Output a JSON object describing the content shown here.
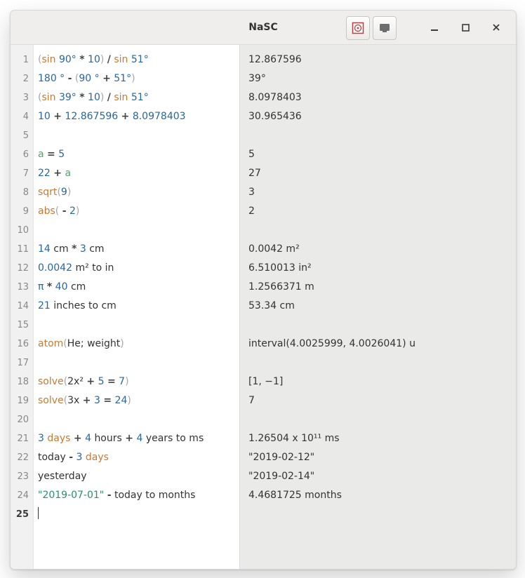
{
  "window": {
    "title": "NaSC"
  },
  "toolbar_icons": {
    "mode": "target-icon",
    "view": "screen-icon"
  },
  "current_line": 25,
  "lines": [
    {
      "n": 1,
      "expr": [
        [
          "paren",
          "("
        ],
        [
          "func",
          "sin"
        ],
        [
          "plain",
          " "
        ],
        [
          "num",
          "90°"
        ],
        [
          "plain",
          " "
        ],
        [
          "op",
          "*"
        ],
        [
          "plain",
          " "
        ],
        [
          "num",
          "10"
        ],
        [
          "paren",
          ")"
        ],
        [
          "plain",
          " "
        ],
        [
          "op",
          "/"
        ],
        [
          "plain",
          " "
        ],
        [
          "func",
          "sin"
        ],
        [
          "plain",
          " "
        ],
        [
          "num",
          "51°"
        ]
      ],
      "result": "12.867596"
    },
    {
      "n": 2,
      "expr": [
        [
          "num",
          "180 °"
        ],
        [
          "plain",
          " "
        ],
        [
          "op",
          "-"
        ],
        [
          "plain",
          " "
        ],
        [
          "paren",
          "("
        ],
        [
          "num",
          "90 °"
        ],
        [
          "plain",
          " "
        ],
        [
          "op",
          "+"
        ],
        [
          "plain",
          " "
        ],
        [
          "num",
          "51°"
        ],
        [
          "paren",
          ")"
        ]
      ],
      "result": "39°"
    },
    {
      "n": 3,
      "expr": [
        [
          "paren",
          "("
        ],
        [
          "func",
          "sin"
        ],
        [
          "plain",
          " "
        ],
        [
          "num",
          "39°"
        ],
        [
          "plain",
          " "
        ],
        [
          "op",
          "*"
        ],
        [
          "plain",
          " "
        ],
        [
          "num",
          "10"
        ],
        [
          "paren",
          ")"
        ],
        [
          "plain",
          " "
        ],
        [
          "op",
          "/"
        ],
        [
          "plain",
          " "
        ],
        [
          "func",
          "sin"
        ],
        [
          "plain",
          " "
        ],
        [
          "num",
          "51°"
        ]
      ],
      "result": "8.0978403"
    },
    {
      "n": 4,
      "expr": [
        [
          "num",
          "10"
        ],
        [
          "plain",
          " "
        ],
        [
          "op",
          "+"
        ],
        [
          "plain",
          " "
        ],
        [
          "num",
          "12.867596"
        ],
        [
          "plain",
          " "
        ],
        [
          "op",
          "+"
        ],
        [
          "plain",
          " "
        ],
        [
          "num",
          "8.0978403"
        ]
      ],
      "result": "30.965436"
    },
    {
      "n": 5,
      "expr": [],
      "result": ""
    },
    {
      "n": 6,
      "expr": [
        [
          "var",
          "a"
        ],
        [
          "plain",
          " "
        ],
        [
          "op",
          "="
        ],
        [
          "plain",
          " "
        ],
        [
          "num",
          "5"
        ]
      ],
      "result": "5"
    },
    {
      "n": 7,
      "expr": [
        [
          "num",
          "22"
        ],
        [
          "plain",
          " "
        ],
        [
          "op",
          "+"
        ],
        [
          "plain",
          " "
        ],
        [
          "var",
          "a"
        ]
      ],
      "result": "27"
    },
    {
      "n": 8,
      "expr": [
        [
          "func",
          "sqrt"
        ],
        [
          "paren",
          "("
        ],
        [
          "num",
          "9"
        ],
        [
          "paren",
          ")"
        ]
      ],
      "result": "3"
    },
    {
      "n": 9,
      "expr": [
        [
          "func",
          "abs"
        ],
        [
          "paren",
          "("
        ],
        [
          "plain",
          " "
        ],
        [
          "op",
          "-"
        ],
        [
          "plain",
          " "
        ],
        [
          "num",
          "2"
        ],
        [
          "paren",
          ")"
        ]
      ],
      "result": "2"
    },
    {
      "n": 10,
      "expr": [],
      "result": ""
    },
    {
      "n": 11,
      "expr": [
        [
          "num",
          "14"
        ],
        [
          "plain",
          " "
        ],
        [
          "kw",
          "cm"
        ],
        [
          "plain",
          " "
        ],
        [
          "op",
          "*"
        ],
        [
          "plain",
          " "
        ],
        [
          "num",
          "3"
        ],
        [
          "plain",
          " "
        ],
        [
          "kw",
          "cm"
        ]
      ],
      "result": "0.0042 m²"
    },
    {
      "n": 12,
      "expr": [
        [
          "num",
          "0.0042"
        ],
        [
          "plain",
          " "
        ],
        [
          "kw",
          "m² to in"
        ]
      ],
      "result": "6.510013 in²"
    },
    {
      "n": 13,
      "expr": [
        [
          "num",
          "π"
        ],
        [
          "plain",
          " "
        ],
        [
          "op",
          "*"
        ],
        [
          "plain",
          " "
        ],
        [
          "num",
          "40"
        ],
        [
          "plain",
          " "
        ],
        [
          "kw",
          "cm"
        ]
      ],
      "result": "1.2566371 m"
    },
    {
      "n": 14,
      "expr": [
        [
          "num",
          "21"
        ],
        [
          "plain",
          " "
        ],
        [
          "kw",
          "inches to cm"
        ]
      ],
      "result": "53.34 cm"
    },
    {
      "n": 15,
      "expr": [],
      "result": ""
    },
    {
      "n": 16,
      "expr": [
        [
          "func",
          "atom"
        ],
        [
          "paren",
          "("
        ],
        [
          "kw",
          "He"
        ],
        [
          "plain",
          "; "
        ],
        [
          "kw",
          "weight"
        ],
        [
          "paren",
          ")"
        ]
      ],
      "result": "interval(4.0025999, 4.0026041) u"
    },
    {
      "n": 17,
      "expr": [],
      "result": ""
    },
    {
      "n": 18,
      "expr": [
        [
          "func",
          "solve"
        ],
        [
          "paren",
          "("
        ],
        [
          "kw",
          "2x²"
        ],
        [
          "plain",
          " "
        ],
        [
          "op",
          "+"
        ],
        [
          "plain",
          " "
        ],
        [
          "num",
          "5"
        ],
        [
          "plain",
          " "
        ],
        [
          "op",
          "="
        ],
        [
          "plain",
          " "
        ],
        [
          "num",
          "7"
        ],
        [
          "paren",
          ")"
        ]
      ],
      "result": "[1, −1]"
    },
    {
      "n": 19,
      "expr": [
        [
          "func",
          "solve"
        ],
        [
          "paren",
          "("
        ],
        [
          "kw",
          "3x "
        ],
        [
          "plain",
          " "
        ],
        [
          "op",
          "+"
        ],
        [
          "plain",
          " "
        ],
        [
          "num",
          "3"
        ],
        [
          "plain",
          " "
        ],
        [
          "op",
          "="
        ],
        [
          "plain",
          " "
        ],
        [
          "num",
          "24"
        ],
        [
          "paren",
          ")"
        ]
      ],
      "result": "7"
    },
    {
      "n": 20,
      "expr": [],
      "result": ""
    },
    {
      "n": 21,
      "expr": [
        [
          "num",
          "3"
        ],
        [
          "plain",
          " "
        ],
        [
          "unit",
          "days"
        ],
        [
          "plain",
          " "
        ],
        [
          "op",
          "+"
        ],
        [
          "plain",
          " "
        ],
        [
          "num",
          "4"
        ],
        [
          "plain",
          " "
        ],
        [
          "kw",
          "hours"
        ],
        [
          "plain",
          " "
        ],
        [
          "op",
          "+"
        ],
        [
          "plain",
          " "
        ],
        [
          "num",
          "4"
        ],
        [
          "plain",
          " "
        ],
        [
          "kw",
          "years to ms"
        ]
      ],
      "result": "1.26504 x 10¹¹ ms"
    },
    {
      "n": 22,
      "expr": [
        [
          "kw",
          "today"
        ],
        [
          "plain",
          " "
        ],
        [
          "op",
          "-"
        ],
        [
          "plain",
          " "
        ],
        [
          "num",
          "3"
        ],
        [
          "plain",
          " "
        ],
        [
          "unit",
          "days"
        ]
      ],
      "result": "\"2019-02-12\""
    },
    {
      "n": 23,
      "expr": [
        [
          "kw",
          "yesterday"
        ]
      ],
      "result": "\"2019-02-14\""
    },
    {
      "n": 24,
      "expr": [
        [
          "str",
          "\"2019-07-01\""
        ],
        [
          "plain",
          " "
        ],
        [
          "op",
          "-"
        ],
        [
          "plain",
          " "
        ],
        [
          "kw",
          "today to months"
        ]
      ],
      "result": "4.4681725 months"
    },
    {
      "n": 25,
      "expr": [],
      "result": ""
    }
  ]
}
